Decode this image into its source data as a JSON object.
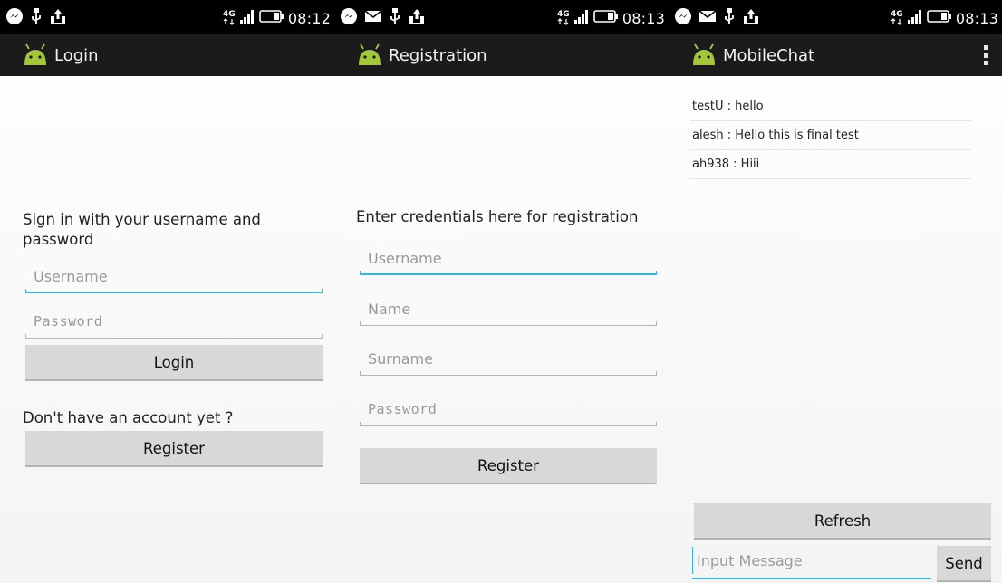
{
  "screens": [
    {
      "status": {
        "time": "08:12",
        "network": "4G"
      },
      "title": "Login",
      "prompt": "Sign in with your username and password",
      "username_placeholder": "Username",
      "password_placeholder": "Password",
      "login_label": "Login",
      "no_account_text": "Don't have an account yet ?",
      "register_label": "Register"
    },
    {
      "status": {
        "time": "08:13",
        "network": "4G"
      },
      "title": "Registration",
      "prompt": "Enter credentials here for registration",
      "username_placeholder": "Username",
      "name_placeholder": "Name",
      "surname_placeholder": "Surname",
      "password_placeholder": "Password",
      "register_label": "Register"
    },
    {
      "status": {
        "time": "08:13",
        "network": "4G"
      },
      "title": "MobileChat",
      "messages": [
        {
          "text": "testU : hello"
        },
        {
          "text": "alesh : Hello this is final test"
        },
        {
          "text": "ah938 : Hiii"
        }
      ],
      "refresh_label": "Refresh",
      "message_placeholder": "Input Message",
      "send_label": "Send"
    }
  ],
  "icons": {
    "status_left": [
      "messenger-icon",
      "usb-icon",
      "upload-icon"
    ],
    "status_left_chat": [
      "messenger-icon",
      "email-icon",
      "usb-icon",
      "upload-icon"
    ],
    "status_right": [
      "network-type-icon",
      "signal-icon",
      "battery-icon"
    ],
    "app": "android-icon",
    "menu": "overflow-menu-icon"
  },
  "colors": {
    "accent": "#33b5e5",
    "statusbar": "#000000",
    "actionbar": "#1b1b1b",
    "button": "#d8d8d8",
    "background": "#f8f8f8",
    "android_green": "#a4c639"
  }
}
